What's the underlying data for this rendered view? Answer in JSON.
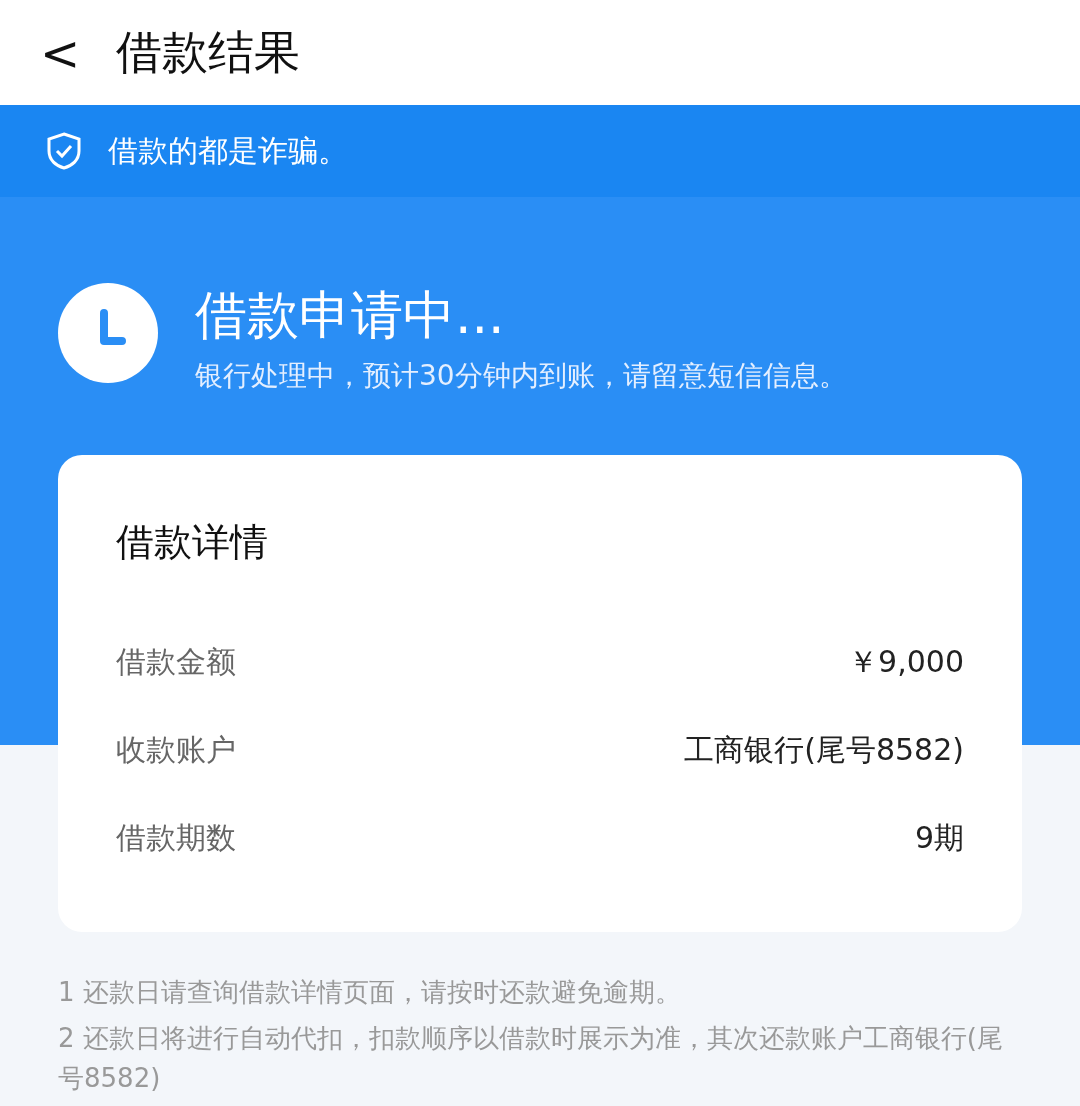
{
  "header": {
    "back_icon": "<",
    "title": "借款结果"
  },
  "notice": {
    "text": "借款的都是诈骗。"
  },
  "status": {
    "title": "借款申请中...",
    "subtitle": "银行处理中，预计30分钟内到账，请留意短信信息。"
  },
  "details": {
    "title": "借款详情",
    "rows": [
      {
        "label": "借款金额",
        "value": "￥9,000"
      },
      {
        "label": "收款账户",
        "value": "工商银行(尾号8582)"
      },
      {
        "label": "借款期数",
        "value": "9期"
      }
    ]
  },
  "notes": [
    "1 还款日请查询借款详情页面，请按时还款避免逾期。",
    "2 还款日将进行自动代扣，扣款顺序以借款时展示为准，其次还款账户工商银行(尾号8582)"
  ]
}
